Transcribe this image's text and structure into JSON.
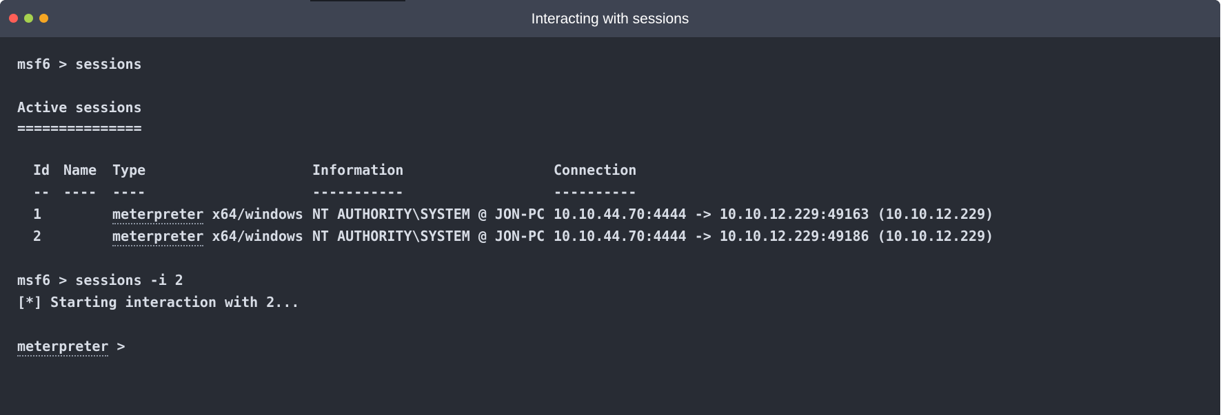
{
  "window": {
    "title": "Interacting with sessions",
    "colors": {
      "titlebar": "#3e4452",
      "background": "#282c34",
      "text": "#d8dde6",
      "close": "#ff5f57",
      "minimize": "#a6d14f",
      "maximize": "#f5a623"
    }
  },
  "terminal": {
    "prompt1": "msf6 > sessions",
    "heading": "Active sessions",
    "heading_rule": "===============",
    "table": {
      "headers": {
        "id": "Id",
        "name": "Name",
        "type": "Type",
        "information": "Information",
        "connection": "Connection"
      },
      "rules": {
        "id": "--",
        "name": "----",
        "type": "----",
        "information": "-----------",
        "connection": "----------"
      },
      "rows": [
        {
          "id": "1",
          "name": "",
          "type_main": "meterpreter",
          "type_rest": " x64/windows",
          "information": "NT AUTHORITY\\SYSTEM @ JON-PC",
          "connection": "10.10.44.70:4444 -> 10.10.12.229:49163 (10.10.12.229)"
        },
        {
          "id": "2",
          "name": "",
          "type_main": "meterpreter",
          "type_rest": " x64/windows",
          "information": "NT AUTHORITY\\SYSTEM @ JON-PC",
          "connection": "10.10.44.70:4444 -> 10.10.12.229:49186 (10.10.12.229)"
        }
      ]
    },
    "prompt2": "msf6 > sessions -i 2",
    "status": "[*] Starting interaction with 2...",
    "prompt3_main": "meterpreter",
    "prompt3_rest": " >"
  }
}
